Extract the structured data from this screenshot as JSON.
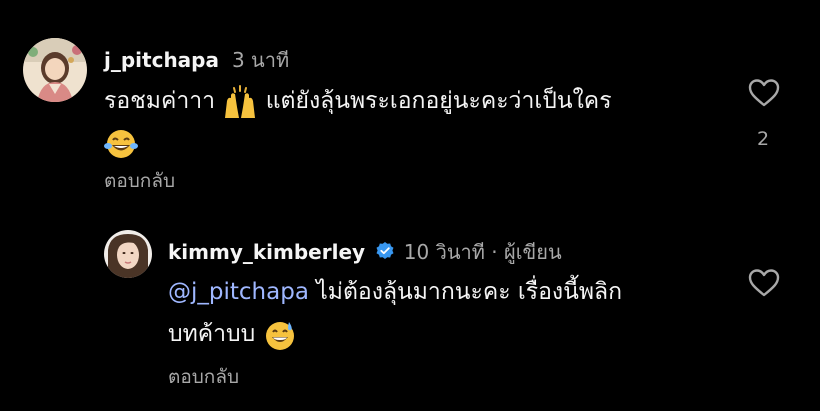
{
  "comments": [
    {
      "username": "j_pitchapa",
      "time": "3 นาที",
      "text_before_emoji": "รอชมค่าาา ",
      "emoji1": "raising-hands",
      "text_after_emoji": " แต่ยังลุ้นพระเอกอยู่นะคะว่าเป็นใคร",
      "emoji2": "face-with-tears-of-joy",
      "like_count": "2",
      "reply_label": "ตอบกลับ"
    }
  ],
  "reply": {
    "username": "kimmy_kimberley",
    "verified": true,
    "time": "10 วินาที",
    "separator": "·",
    "author_label": "ผู้เขียน",
    "mention": "@j_pitchapa",
    "text_line1": " ไม่ต้องลุ้นมากนะคะ เรื่องนี้พลิก",
    "text_line2": "บทค้าบบ ",
    "emoji": "grinning-face-with-sweat",
    "reply_label": "ตอบกลับ"
  },
  "colors": {
    "background": "#000000",
    "text": "#f5f5f5",
    "muted": "#a8a8a8",
    "mention": "#9fb7ff",
    "verified": "#3897f0"
  }
}
